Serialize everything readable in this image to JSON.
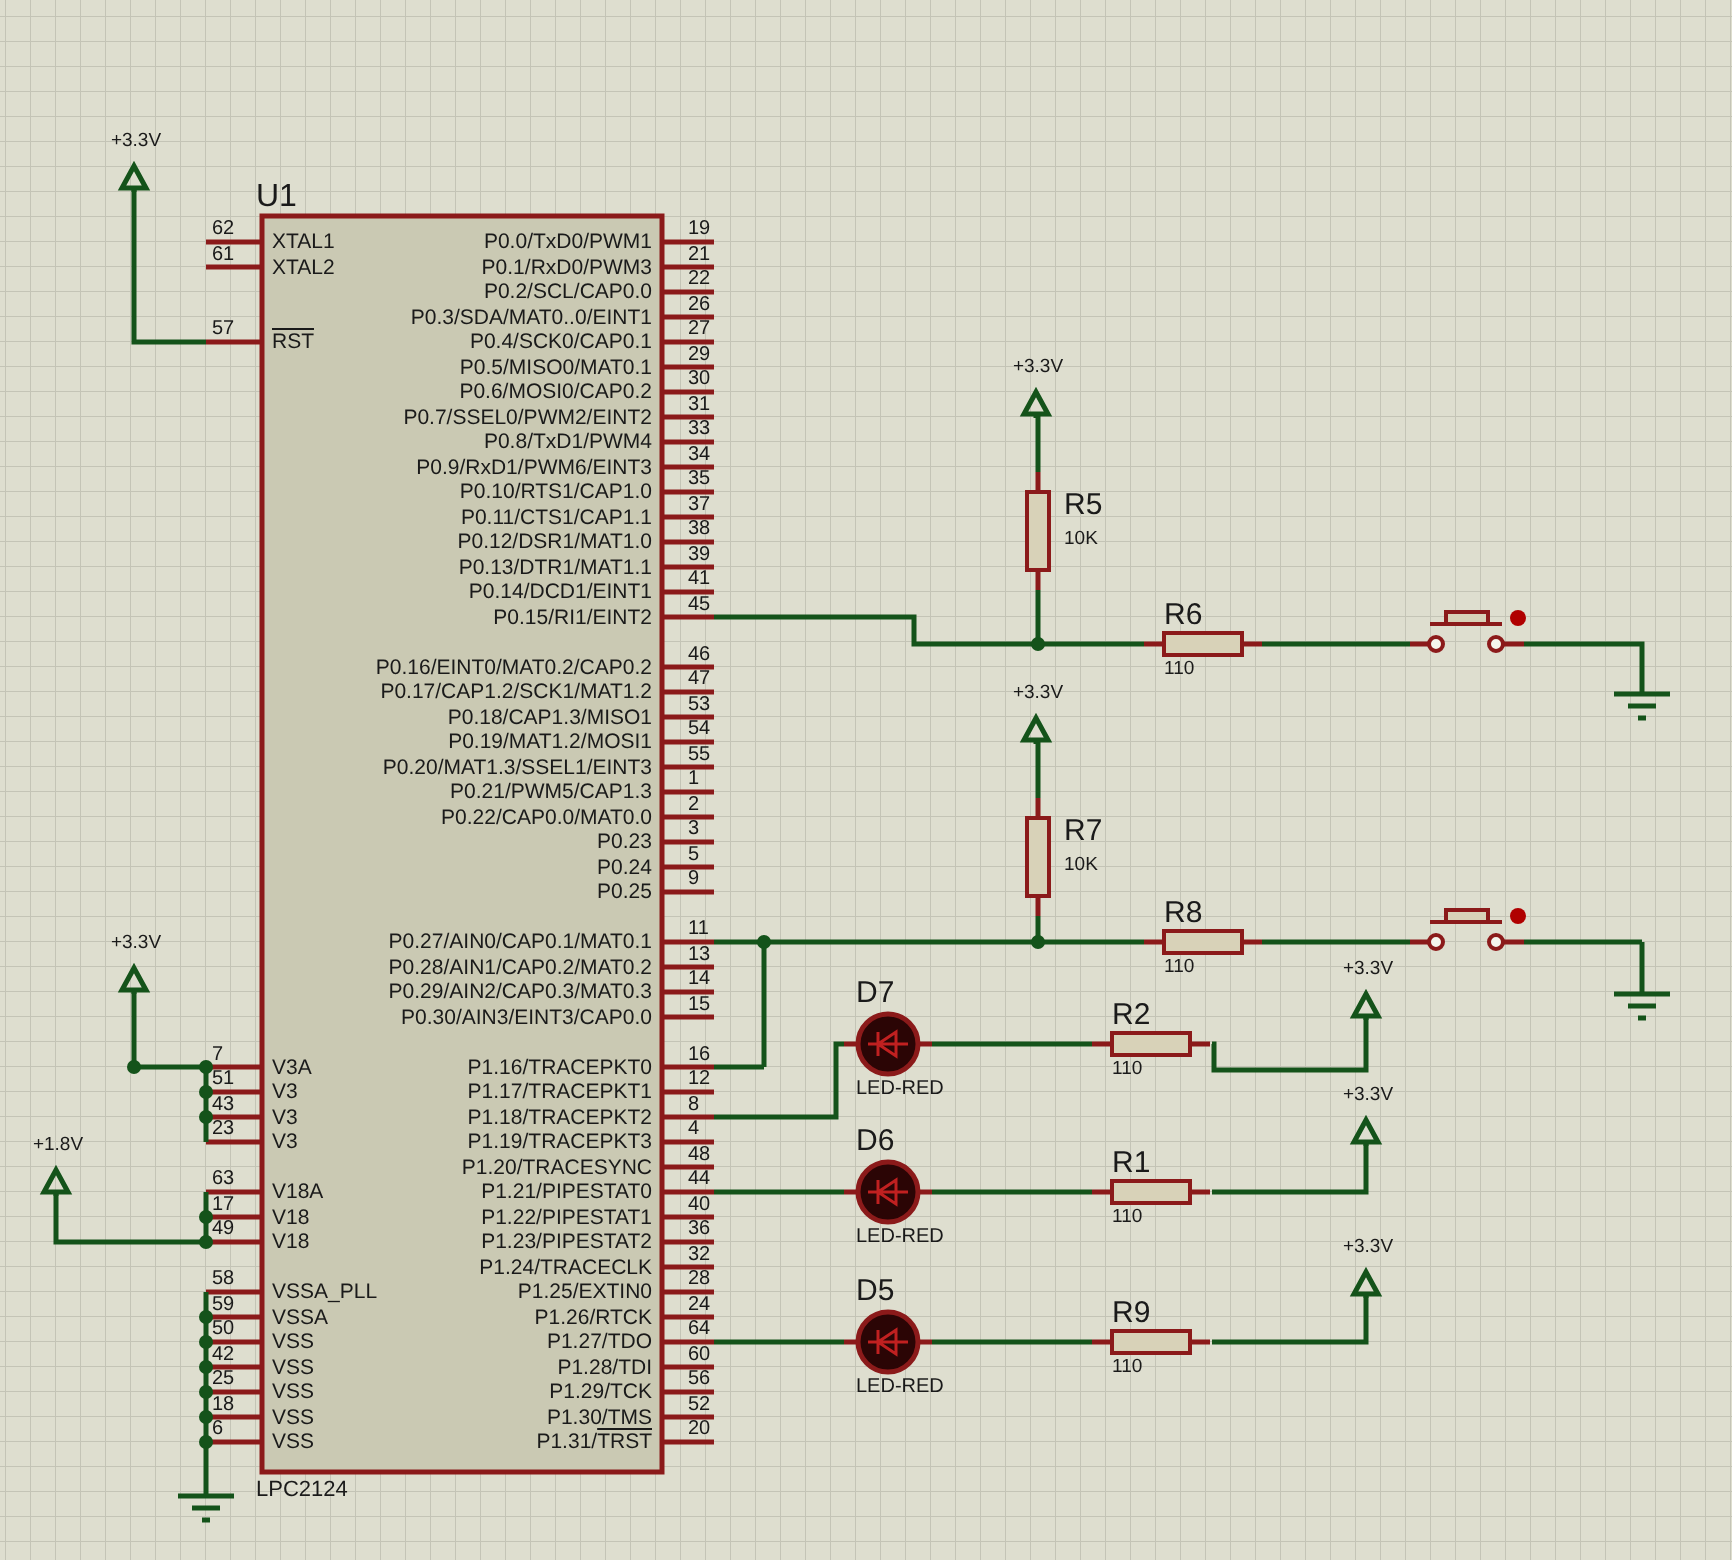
{
  "schematic": {
    "chip": {
      "ref": "U1",
      "part": "LPC2124",
      "left_pin_groups": [
        [
          {
            "name": "XTAL1",
            "number": "62"
          },
          {
            "name": "XTAL2",
            "number": "61"
          }
        ],
        [
          {
            "overbar": "RST",
            "number": "57"
          }
        ],
        [
          {
            "name": "V3A",
            "number": "7"
          },
          {
            "name": "V3",
            "number": "51"
          },
          {
            "name": "V3",
            "number": "43"
          },
          {
            "name": "V3",
            "number": "23"
          }
        ],
        [
          {
            "name": "V18A",
            "number": "63"
          },
          {
            "name": "V18",
            "number": "17"
          },
          {
            "name": "V18",
            "number": "49"
          }
        ],
        [
          {
            "name": "VSSA_PLL",
            "number": "58"
          },
          {
            "name": "VSSA",
            "number": "59"
          },
          {
            "name": "VSS",
            "number": "50"
          },
          {
            "name": "VSS",
            "number": "42"
          },
          {
            "name": "VSS",
            "number": "25"
          },
          {
            "name": "VSS",
            "number": "18"
          },
          {
            "name": "VSS",
            "number": "6"
          }
        ]
      ],
      "right_pin_groups": [
        [
          {
            "name": "P0.0/TxD0/PWM1",
            "number": "19"
          },
          {
            "name": "P0.1/RxD0/PWM3",
            "number": "21"
          },
          {
            "name": "P0.2/SCL/CAP0.0",
            "number": "22"
          },
          {
            "name": "P0.3/SDA/MAT0..0/EINT1",
            "number": "26"
          },
          {
            "name": "P0.4/SCK0/CAP0.1",
            "number": "27"
          },
          {
            "name": "P0.5/MISO0/MAT0.1",
            "number": "29"
          },
          {
            "name": "P0.6/MOSI0/CAP0.2",
            "number": "30"
          },
          {
            "name": "P0.7/SSEL0/PWM2/EINT2",
            "number": "31"
          },
          {
            "name": "P0.8/TxD1/PWM4",
            "number": "33"
          },
          {
            "name": "P0.9/RxD1/PWM6/EINT3",
            "number": "34"
          },
          {
            "name": "P0.10/RTS1/CAP1.0",
            "number": "35"
          },
          {
            "name": "P0.11/CTS1/CAP1.1",
            "number": "37"
          },
          {
            "name": "P0.12/DSR1/MAT1.0",
            "number": "38"
          },
          {
            "name": "P0.13/DTR1/MAT1.1",
            "number": "39"
          },
          {
            "name": "P0.14/DCD1/EINT1",
            "number": "41"
          },
          {
            "name": "P0.15/RI1/EINT2",
            "number": "45"
          }
        ],
        [
          {
            "name": "P0.16/EINT0/MAT0.2/CAP0.2",
            "number": "46"
          },
          {
            "name": "P0.17/CAP1.2/SCK1/MAT1.2",
            "number": "47"
          },
          {
            "name": "P0.18/CAP1.3/MISO1",
            "number": "53"
          },
          {
            "name": "P0.19/MAT1.2/MOSI1",
            "number": "54"
          },
          {
            "name": "P0.20/MAT1.3/SSEL1/EINT3",
            "number": "55"
          },
          {
            "name": "P0.21/PWM5/CAP1.3",
            "number": "1"
          },
          {
            "name": "P0.22/CAP0.0/MAT0.0",
            "number": "2"
          },
          {
            "name": "P0.23",
            "number": "3"
          },
          {
            "name": "P0.24",
            "number": "5"
          },
          {
            "name": "P0.25",
            "number": "9"
          }
        ],
        [
          {
            "name": "P0.27/AIN0/CAP0.1/MAT0.1",
            "number": "11"
          },
          {
            "name": "P0.28/AIN1/CAP0.2/MAT0.2",
            "number": "13"
          },
          {
            "name": "P0.29/AIN2/CAP0.3/MAT0.3",
            "number": "14"
          },
          {
            "name": "P0.30/AIN3/EINT3/CAP0.0",
            "number": "15"
          }
        ],
        [
          {
            "name": "P1.16/TRACEPKT0",
            "number": "16"
          },
          {
            "name": "P1.17/TRACEPKT1",
            "number": "12"
          },
          {
            "name": "P1.18/TRACEPKT2",
            "number": "8"
          },
          {
            "name": "P1.19/TRACEPKT3",
            "number": "4"
          },
          {
            "name": "P1.20/TRACESYNC",
            "number": "48"
          },
          {
            "name": "P1.21/PIPESTAT0",
            "number": "44"
          },
          {
            "name": "P1.22/PIPESTAT1",
            "number": "40"
          },
          {
            "name": "P1.23/PIPESTAT2",
            "number": "36"
          },
          {
            "name": "P1.24/TRACECLK",
            "number": "32"
          },
          {
            "name": "P1.25/EXTIN0",
            "number": "28"
          },
          {
            "name": "P1.26/RTCK",
            "number": "24"
          },
          {
            "name": "P1.27/TDO",
            "number": "64"
          },
          {
            "name": "P1.28/TDI",
            "number": "60"
          },
          {
            "name": "P1.29/TCK",
            "number": "56"
          },
          {
            "name": "P1.30/TMS",
            "number": "52"
          },
          {
            "name": "P1.31/",
            "overbar": "TRST",
            "number": "20"
          }
        ]
      ]
    },
    "power_terminals": [
      {
        "label": "+3.3V"
      },
      {
        "label": "+3.3V"
      },
      {
        "label": "+3.3V"
      },
      {
        "label": "+3.3V"
      },
      {
        "label": "+1.8V"
      },
      {
        "label": "+3.3V"
      },
      {
        "label": "+3.3V"
      },
      {
        "label": "+3.3V"
      }
    ],
    "resistors": [
      {
        "ref": "R5",
        "value": "10K",
        "kind": "vertical"
      },
      {
        "ref": "R6",
        "value": "110",
        "kind": "horizontal"
      },
      {
        "ref": "R7",
        "value": "10K",
        "kind": "vertical"
      },
      {
        "ref": "R8",
        "value": "110",
        "kind": "horizontal"
      },
      {
        "ref": "R2",
        "value": "110",
        "kind": "horizontal"
      },
      {
        "ref": "R1",
        "value": "110",
        "kind": "horizontal"
      },
      {
        "ref": "R9",
        "value": "110",
        "kind": "horizontal"
      }
    ],
    "leds": [
      {
        "ref": "D7",
        "part": "LED-RED"
      },
      {
        "ref": "D6",
        "part": "LED-RED"
      },
      {
        "ref": "D5",
        "part": "LED-RED"
      }
    ]
  }
}
